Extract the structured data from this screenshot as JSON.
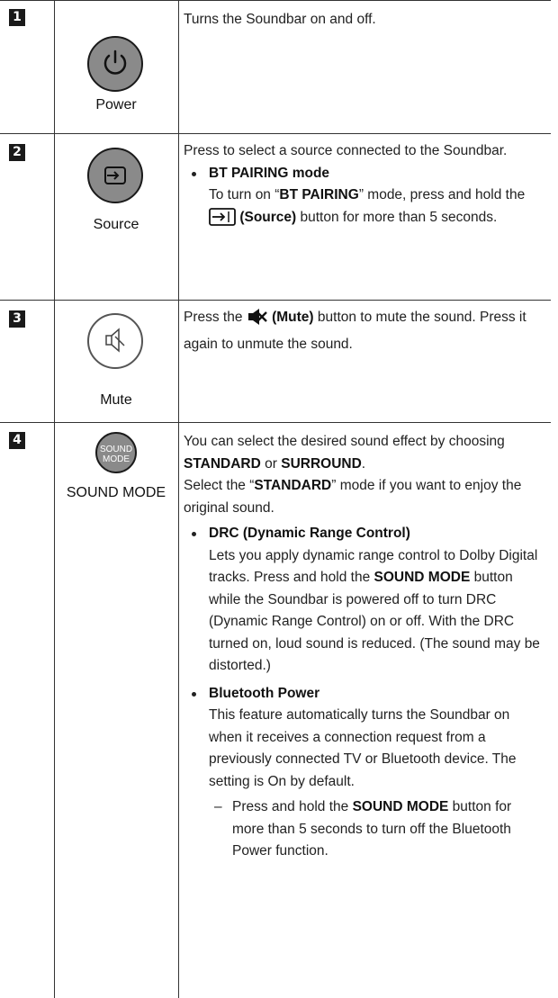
{
  "rows": [
    {
      "number": "1",
      "icon": "power-icon",
      "label": "Power",
      "text": "Turns the Soundbar on and off."
    },
    {
      "number": "2",
      "icon": "source-icon",
      "label": "Source",
      "text": "Press to select a source connected to the Soundbar.",
      "bullet_title": "BT PAIRING mode",
      "bullet_pre": "To turn on “",
      "bullet_bold": "BT PAIRING",
      "bullet_mid": "” mode, press and hold the ",
      "bullet_icon_label": "(Source)",
      "bullet_post": " button for more than 5 seconds."
    },
    {
      "number": "3",
      "icon": "mute-icon",
      "label": "Mute",
      "text_pre": "Press the ",
      "icon_label": "(Mute)",
      "text_post": " button to mute the sound. Press it again to unmute the sound."
    },
    {
      "number": "4",
      "icon": "sound-mode-button-icon",
      "button_text_1": "SOUND",
      "button_text_2": "MODE",
      "label": "SOUND MODE",
      "p1_pre": "You can select the desired sound effect by choosing ",
      "p1_b1": "STANDARD",
      "p1_mid": " or ",
      "p1_b2": "SURROUND",
      "p1_post": ".",
      "p2_pre": "Select the “",
      "p2_b": "STANDARD",
      "p2_post": "” mode if you want to enjoy the original sound.",
      "drc_title": "DRC (Dynamic Range Control)",
      "drc_pre": "Lets you apply dynamic range control to Dolby Digital tracks. Press and hold the ",
      "drc_b": "SOUND MODE",
      "drc_post": " button while the Soundbar is powered off to turn DRC (Dynamic Range Control) on or off. With the DRC turned on, loud sound is reduced. (The sound may be distorted.)",
      "bt_title": "Bluetooth Power",
      "bt_text": "This feature automatically turns the Soundbar on when it receives a connection request from a previously connected TV or Bluetooth device. The setting is On by default.",
      "dash_mark": "–",
      "dash_pre": "Press and hold the ",
      "dash_b": "SOUND MODE",
      "dash_post": " button for more than 5 seconds to turn off the Bluetooth Power function."
    }
  ],
  "colors": {
    "badge_bg": "#1a1a1a",
    "button_fill": "#8a8a8a",
    "rule": "#333333"
  }
}
